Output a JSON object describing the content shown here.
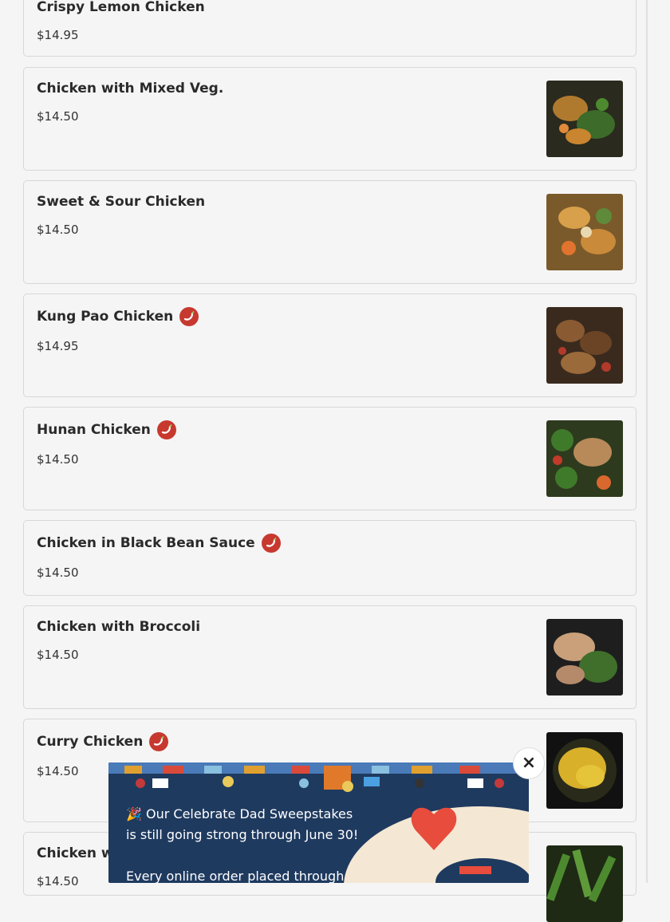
{
  "menu": {
    "items": [
      {
        "name": "Crispy Lemon Chicken",
        "price": "$14.95",
        "spicy": false,
        "image": false
      },
      {
        "name": "Chicken with Mixed Veg.",
        "price": "$14.50",
        "spicy": false,
        "image": true
      },
      {
        "name": "Sweet & Sour Chicken",
        "price": "$14.50",
        "spicy": false,
        "image": true
      },
      {
        "name": "Kung Pao Chicken",
        "price": "$14.95",
        "spicy": true,
        "image": true
      },
      {
        "name": "Hunan Chicken",
        "price": "$14.50",
        "spicy": true,
        "image": true
      },
      {
        "name": "Chicken in Black Bean Sauce",
        "price": "$14.50",
        "spicy": true,
        "image": false
      },
      {
        "name": "Chicken with Broccoli",
        "price": "$14.50",
        "spicy": false,
        "image": true
      },
      {
        "name": "Curry Chicken",
        "price": "$14.50",
        "spicy": true,
        "image": true
      },
      {
        "name": "Chicken wi",
        "price": "$14.50",
        "spicy": false,
        "image": true
      }
    ]
  },
  "popup": {
    "line1": "🎉 Our Celebrate Dad Sweepstakes",
    "line2": "is still going strong through June 30!",
    "line3": "Every online order placed through",
    "close_label": "×"
  },
  "colors": {
    "spicy_badge": "#c7392f",
    "popup_bg": "#1f3a5f",
    "heart": "#e84c3d"
  },
  "icons": {
    "spicy": "chili-pepper-icon",
    "close": "close-icon"
  }
}
